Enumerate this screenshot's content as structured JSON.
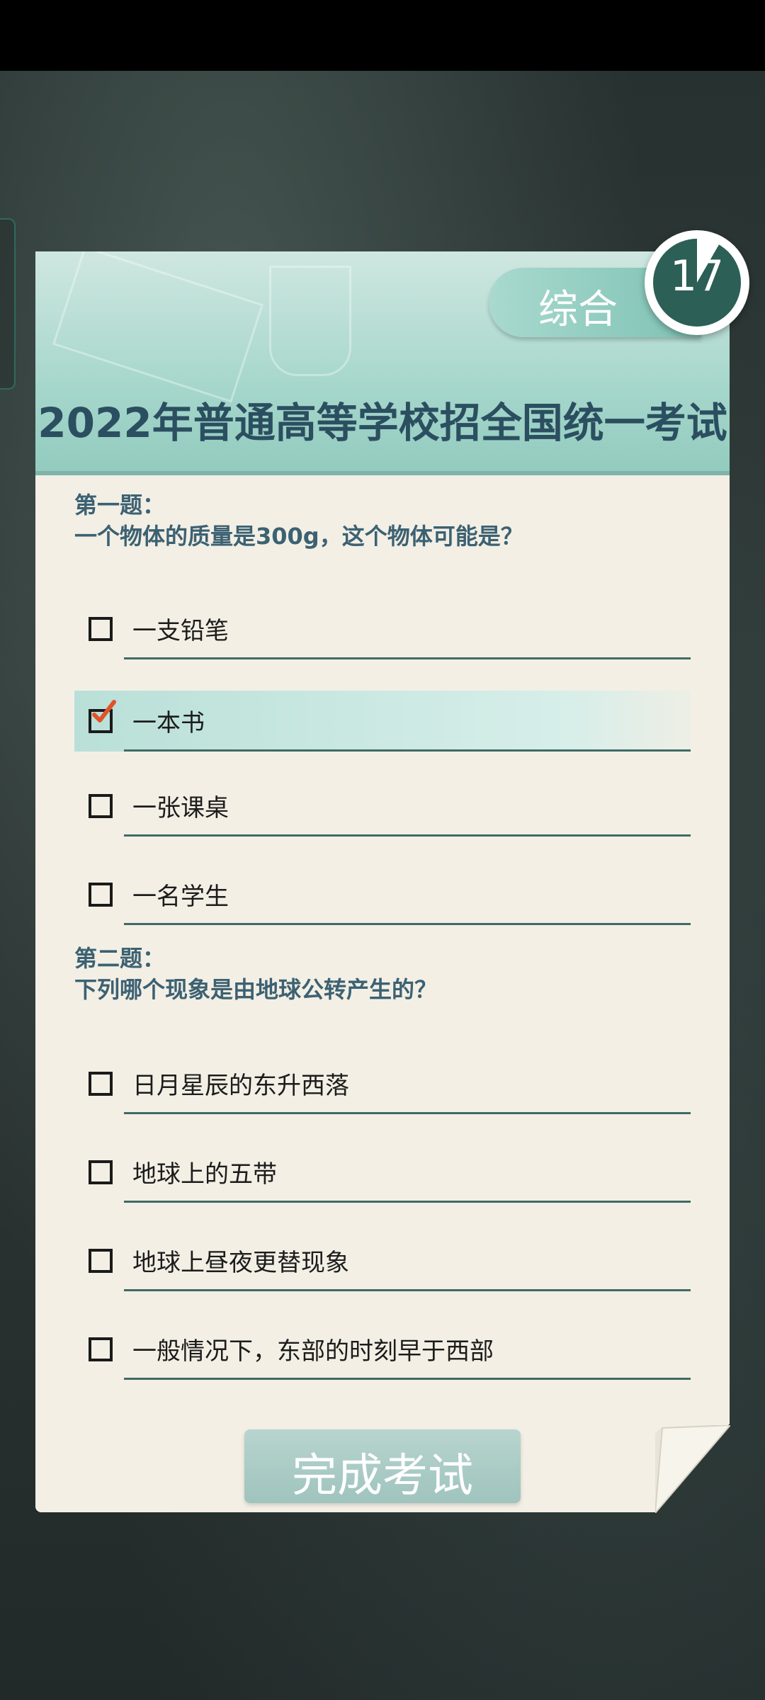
{
  "exam": {
    "title": "2022年普通高等学校招全国统一考试",
    "category": "综合",
    "timer": "17",
    "finish_label": "完成考试"
  },
  "questions": [
    {
      "label": "第一题：",
      "text": "一个物体的质量是300g，这个物体可能是？",
      "options": [
        {
          "label": "一支铅笔",
          "checked": false
        },
        {
          "label": "一本书",
          "checked": true
        },
        {
          "label": "一张课桌",
          "checked": false
        },
        {
          "label": "一名学生",
          "checked": false
        }
      ]
    },
    {
      "label": "第二题：",
      "text": "下列哪个现象是由地球公转产生的？",
      "options": [
        {
          "label": "日月星辰的东升西落",
          "checked": false
        },
        {
          "label": "地球上的五带",
          "checked": false
        },
        {
          "label": "地球上昼夜更替现象",
          "checked": false
        },
        {
          "label": "一般情况下，东部的时刻早于西部",
          "checked": false
        }
      ]
    }
  ],
  "colors": {
    "accent": "#2c5f55",
    "header": "#a7d7cc",
    "check": "#e0532a"
  }
}
